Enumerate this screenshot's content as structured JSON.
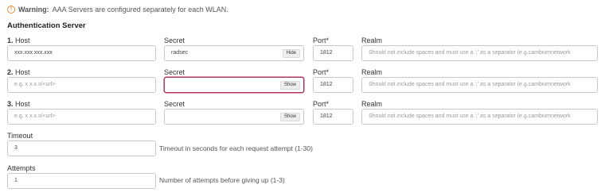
{
  "warning": {
    "prefix": "Warning:",
    "text": "AAA Servers are configured separately for each WLAN."
  },
  "section_title": "Authentication Server",
  "column_labels": {
    "host": "Host",
    "secret": "Secret",
    "port": "Port*",
    "realm": "Realm"
  },
  "servers": [
    {
      "index": "1.",
      "host_value": "xxx.xxx.xxx.xxx",
      "host_placeholder": "",
      "secret_value": "radsec",
      "secret_toggle": "Hide",
      "port": "1812",
      "realm_placeholder": "Should not include spaces and must use a ',' as a separator (e.g.cambiumnetwork"
    },
    {
      "index": "2.",
      "host_value": "",
      "host_placeholder": "e.g. x.x.x.x/<url>",
      "secret_value": "",
      "secret_toggle": "Show",
      "port": "1812",
      "realm_placeholder": "Should not include spaces and must use a ',' as a separator (e.g.cambiumnetwork"
    },
    {
      "index": "3.",
      "host_value": "",
      "host_placeholder": "e.g. x.x.x.x/<url>",
      "secret_value": "",
      "secret_toggle": "Show",
      "port": "1812",
      "realm_placeholder": "Should not include spaces and must use a ',' as a separator (e.g.cambiumnetwork"
    }
  ],
  "timeout": {
    "label": "Timeout",
    "value": "3",
    "hint": "Timeout in seconds for each request attempt (1-30)"
  },
  "attempts": {
    "label": "Attempts",
    "value": "1",
    "hint": "Number of attempts before giving up (1-3)"
  },
  "colors": {
    "warning_icon": "#e08a3c",
    "focus_border": "#b0355f"
  }
}
